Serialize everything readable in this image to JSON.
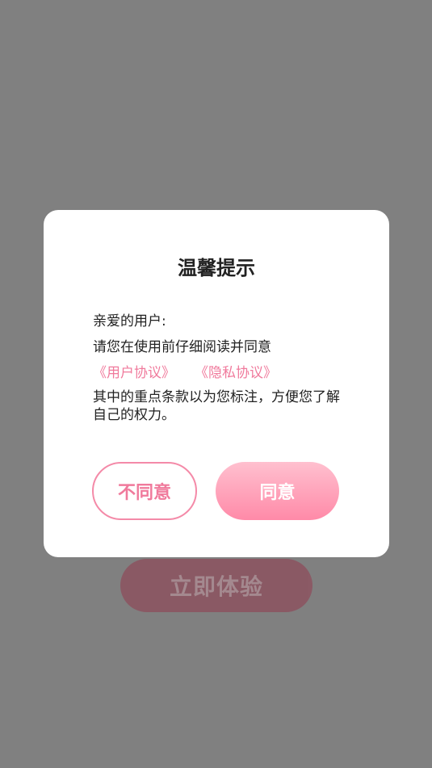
{
  "background": {
    "cta_label": "立即体验"
  },
  "modal": {
    "title": "温馨提示",
    "greeting": "亲爱的用户:",
    "instruction": "请您在使用前仔细阅读并同意",
    "links": {
      "user_agreement": "《用户协议》",
      "privacy_policy": "《隐私协议》"
    },
    "terms_note": "其中的重点条款以为您标注，方便您了解自己的权力。",
    "buttons": {
      "disagree": "不同意",
      "agree": "同意"
    }
  },
  "colors": {
    "overlay": "#808080",
    "accent": "#f07a9c",
    "agree_gradient_top": "#ffc0cf",
    "agree_gradient_bottom": "#ff8aa8"
  }
}
